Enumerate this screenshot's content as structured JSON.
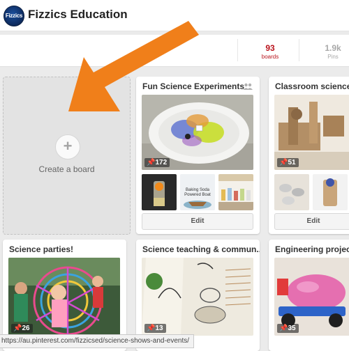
{
  "header": {
    "logo_text": "Fizzics",
    "brand": "Fizzics Education"
  },
  "stats": {
    "boards_count": "93",
    "boards_label": "boards",
    "pins_count": "1.9k",
    "pins_label": "Pins"
  },
  "create_board": {
    "plus": "+",
    "label": "Create a board"
  },
  "boards": [
    {
      "title": "Fun Science Experiments",
      "pin_count": "172",
      "thumb_caption": "Baking Soda Powered Boat",
      "edit_label": "Edit"
    },
    {
      "title": "Classroom science c",
      "pin_count": "51",
      "edit_label": "Edit"
    },
    {
      "title": "Science parties!",
      "pin_count": "26"
    },
    {
      "title": "Science teaching & commun...",
      "pin_count": "13"
    },
    {
      "title": "Engineering projects",
      "pin_count": "35"
    }
  ],
  "statusbar": {
    "url": "https://au.pinterest.com/fizzicsed/science-shows-and-events/"
  },
  "colors": {
    "accent_red": "#b9121b",
    "arrow_orange": "#f07f1a"
  }
}
